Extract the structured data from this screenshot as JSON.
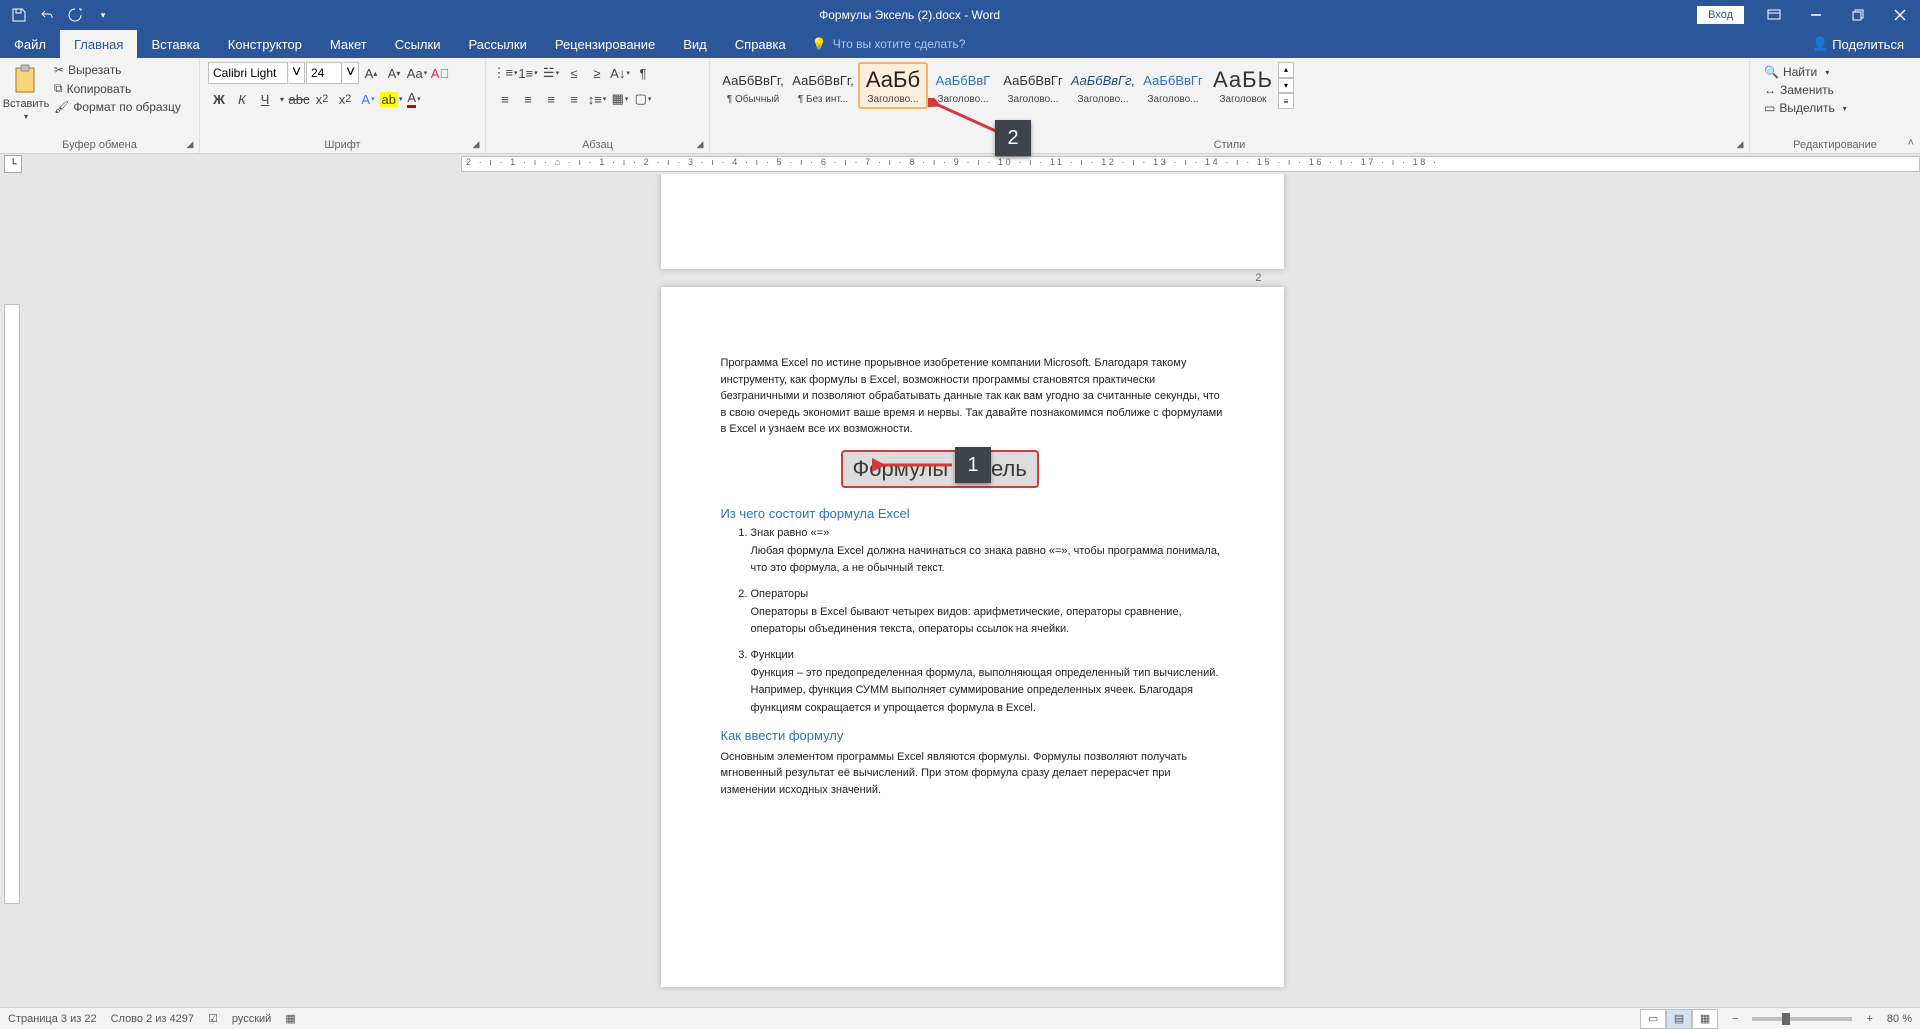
{
  "title": "Формулы Эксель (2).docx - Word",
  "login": "Вход",
  "tabs": {
    "file": "Файл",
    "home": "Главная",
    "insert": "Вставка",
    "design": "Конструктор",
    "layout": "Макет",
    "references": "Ссылки",
    "mailings": "Рассылки",
    "review": "Рецензирование",
    "view": "Вид",
    "help": "Справка"
  },
  "tellme": "Что вы хотите сделать?",
  "share": "Поделиться",
  "clipboard": {
    "paste": "Вставить",
    "cut": "Вырезать",
    "copy": "Копировать",
    "painter": "Формат по образцу",
    "label": "Буфер обмена"
  },
  "font": {
    "name": "Calibri Light",
    "size": "24",
    "label": "Шрифт"
  },
  "paragraph": {
    "label": "Абзац"
  },
  "styles": {
    "items": [
      {
        "preview": "АаБбВвГг,",
        "name": "¶ Обычный"
      },
      {
        "preview": "АаБбВвГг,",
        "name": "¶ Без инт..."
      },
      {
        "preview": "АаБб",
        "name": "Заголово..."
      },
      {
        "preview": "АаБбВвГ",
        "name": "Заголово..."
      },
      {
        "preview": "АаБбВвГг",
        "name": "Заголово..."
      },
      {
        "preview": "АаБбВвГг,",
        "name": "Заголово..."
      },
      {
        "preview": "АаБбВвГг",
        "name": "Заголово..."
      },
      {
        "preview": "АаБЬ",
        "name": "Заголовок"
      }
    ],
    "label": "Стили"
  },
  "editing": {
    "find": "Найти",
    "replace": "Заменить",
    "select": "Выделить",
    "label": "Редактирование"
  },
  "document": {
    "pageNum": "2",
    "intro": "Программа Excel по истине прорывное изобретение компании Microsoft. Благодаря такому инструменту, как формулы в Excel, возможности программы становятся практически безграничными и позволяют обрабатывать данные так как вам угодно за считанные секунды, что в свою очередь экономит ваше время и нервы. Так давайте познакомимся поближе с формулами в Excel и узнаем все их возможности.",
    "selectedTitle": "Формулы Эксель",
    "h2a": "Из чего состоит формула Excel",
    "li1": "Знак равно «=»",
    "li1d": "Любая формула Excel должна начинаться со знака равно «=», чтобы программа понимала, что это формула, а не обычный текст.",
    "li2": "Операторы",
    "li2d": "Операторы в Excel бывают четырех видов: арифметические, операторы сравнение, операторы объединения текста, операторы ссылок на ячейки.",
    "li3": "Функции",
    "li3d": "Функция – это предопределенная формула, выполняющая определенный тип вычислений. Например, функция СУММ выполняет суммирование определенных ячеек. Благодаря функциям сокращается и упрощается формула в Excel.",
    "h2b": "Как ввести формулу",
    "para2": "Основным элементом программы Excel являются формулы. Формулы позволяют получать мгновенный результат её вычислений. При этом формула сразу делает перерасчет при изменении исходных значений."
  },
  "status": {
    "page": "Страница 3 из 22",
    "words": "Слово 2 из 4297",
    "lang": "русский",
    "zoom": "80 %"
  },
  "anno": {
    "one": "1",
    "two": "2"
  },
  "ruler": "2 · ı · 1 · ı · ⌂ · ı · 1 · ı · 2 · ı · 3 · ı · 4 · ı · 5 · ı · 6 · ı · 7 · ı · 8 · ı · 9 · ı · 10 · ı · 11 · ı · 12 · ı · 13 · ı · 14 · ı · 15 · ı · 16 · ı · 17 · ı · 18 ·"
}
